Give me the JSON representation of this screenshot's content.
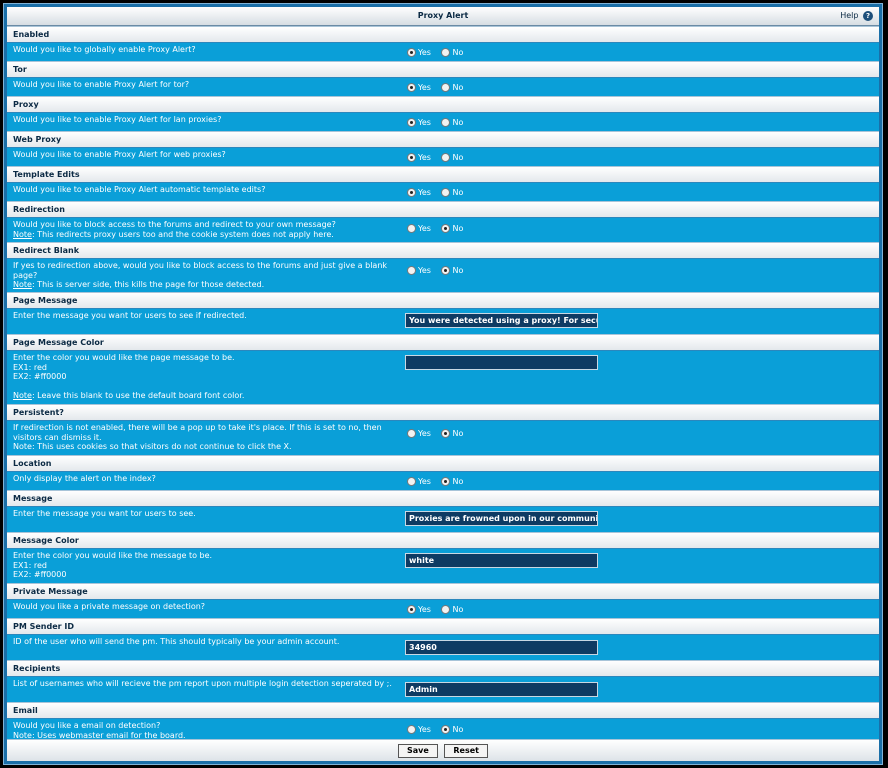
{
  "window": {
    "title": "Proxy Alert",
    "help_label": "Help",
    "help_icon_glyph": "?"
  },
  "radio": {
    "yes": "Yes",
    "no": "No"
  },
  "sections": {
    "enabled": {
      "title": "Enabled",
      "desc": "Would you like to globally enable Proxy Alert?",
      "selected": "yes"
    },
    "tor": {
      "title": "Tor",
      "desc": "Would you like to enable Proxy Alert for tor?",
      "selected": "yes"
    },
    "proxy": {
      "title": "Proxy",
      "desc": "Would you like to enable Proxy Alert for lan proxies?",
      "selected": "yes"
    },
    "web_proxy": {
      "title": "Web Proxy",
      "desc": "Would you like to enable Proxy Alert for web proxies?",
      "selected": "yes"
    },
    "template_edits": {
      "title": "Template Edits",
      "desc": "Would you like to enable Proxy Alert automatic template edits?",
      "selected": "yes"
    },
    "redirection": {
      "title": "Redirection",
      "desc": "Would you like to block access to the forums and redirect to your own message?",
      "note_label": "Note",
      "note": ": This redirects proxy users too and the cookie system does not apply here.",
      "selected": "no"
    },
    "redirect_blank": {
      "title": "Redirect Blank",
      "desc": "If yes to redirection above, would you like to block access to the forums and just give a blank page?",
      "note_label": "Note",
      "note": ": This is server side, this kills the page for those detected.",
      "selected": "no"
    },
    "page_message": {
      "title": "Page Message",
      "desc": "Enter the message you want tor users to see if redirected.",
      "value": "You were detected using a proxy! For security"
    },
    "page_message_color": {
      "title": "Page Message Color",
      "desc": "Enter the color you would like the page message to be.",
      "ex1": "EX1: red",
      "ex2": "EX2: #ff0000",
      "note_label": "Note",
      "note": ": Leave this blank to use the default board font color.",
      "value": ""
    },
    "persistent": {
      "title": "Persistent?",
      "desc": "If redirection is not enabled, there will be a pop up to take it's place. If this is set to no, then visitors can dismiss it.",
      "note": "Note: This uses cookies so that visitors do not continue to click the X.",
      "selected": "no"
    },
    "location": {
      "title": "Location",
      "desc": "Only display the alert on the index?",
      "selected": "no"
    },
    "message": {
      "title": "Message",
      "desc": "Enter the message you want tor users to see.",
      "value": "Proxies are frowned upon in our community, p"
    },
    "message_color": {
      "title": "Message Color",
      "desc": "Enter the color you would like the message to be.",
      "ex1": "EX1: red",
      "ex2": "EX2: #ff0000",
      "value": "white"
    },
    "private_message": {
      "title": "Private Message",
      "desc": "Would you like a private message on detection?",
      "selected": "yes"
    },
    "pm_sender": {
      "title": "PM Sender ID",
      "desc": "ID of the user who will send the pm. This should typically be your admin account.",
      "value": "34960"
    },
    "recipients": {
      "title": "Recipients",
      "desc": "List of usernames who will recieve the pm report upon multiple login detection seperated by ;.",
      "value": "Admin"
    },
    "email": {
      "title": "Email",
      "desc": "Would you like a email on detection?",
      "note_label": "Note",
      "note": ": Uses webmaster email for the board.",
      "selected": "no"
    }
  },
  "footer": {
    "save": "Save",
    "reset": "Reset"
  }
}
